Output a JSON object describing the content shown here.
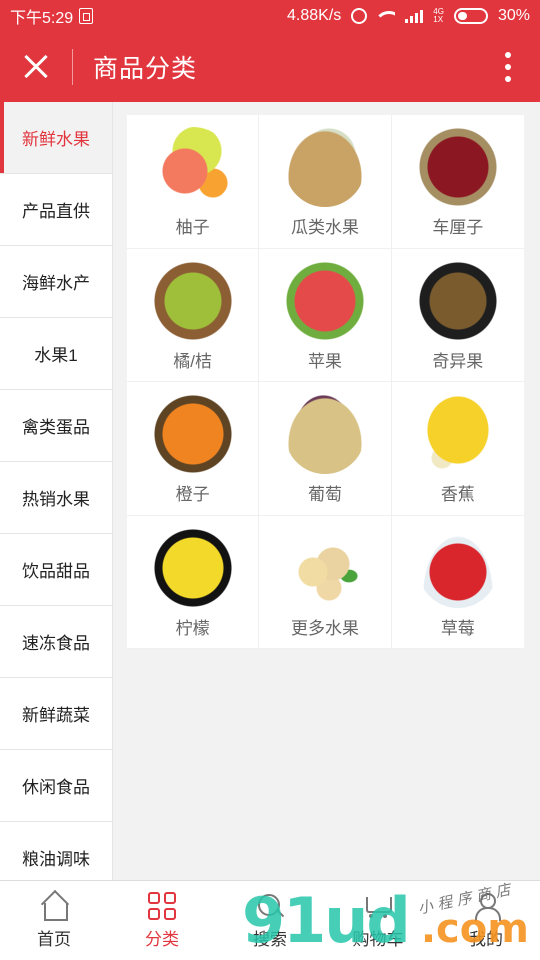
{
  "status": {
    "time": "下午5:29",
    "speed": "4.88K/s",
    "net_top": "4G",
    "net_bottom": "1X",
    "battery": "30%"
  },
  "header": {
    "title": "商品分类"
  },
  "sidebar": {
    "items": [
      {
        "label": "新鲜水果"
      },
      {
        "label": "产品直供"
      },
      {
        "label": "海鲜水产"
      },
      {
        "label": "水果1"
      },
      {
        "label": "禽类蛋品"
      },
      {
        "label": "热销水果"
      },
      {
        "label": "饮品甜品"
      },
      {
        "label": "速冻食品"
      },
      {
        "label": "新鲜蔬菜"
      },
      {
        "label": "休闲食品"
      },
      {
        "label": "粮油调味"
      }
    ],
    "active": "新鲜水果"
  },
  "categories": [
    {
      "label": "柚子",
      "icon": "pomelo-icon"
    },
    {
      "label": "瓜类水果",
      "icon": "melon-icon"
    },
    {
      "label": "车厘子",
      "icon": "cherry-icon"
    },
    {
      "label": "橘/桔",
      "icon": "tangerine-icon"
    },
    {
      "label": "苹果",
      "icon": "apple-icon"
    },
    {
      "label": "奇异果",
      "icon": "kiwi-icon"
    },
    {
      "label": "橙子",
      "icon": "orange-icon"
    },
    {
      "label": "葡萄",
      "icon": "grape-icon"
    },
    {
      "label": "香蕉",
      "icon": "banana-icon"
    },
    {
      "label": "柠檬",
      "icon": "lemon-icon"
    },
    {
      "label": "更多水果",
      "icon": "more-fruit-icon"
    },
    {
      "label": "草莓",
      "icon": "strawberry-icon"
    }
  ],
  "tabbar": {
    "home": "首页",
    "category": "分类",
    "search": "搜索",
    "cart": "购物车",
    "mine": "我的",
    "active": "分类"
  },
  "watermark": {
    "brand": "91ud",
    "suffix": ".com",
    "script": "小 程 序 商 店"
  },
  "colors": {
    "accent": "#e2363f",
    "background": "#f2f2f2"
  }
}
